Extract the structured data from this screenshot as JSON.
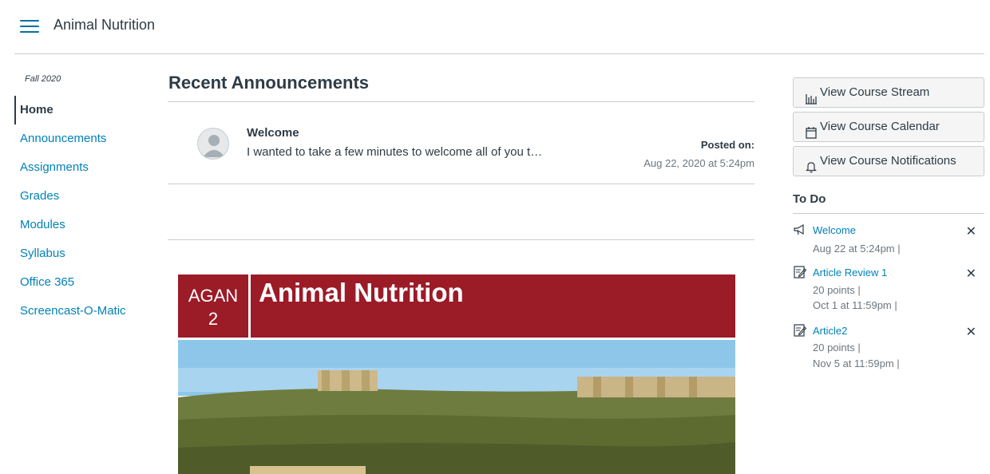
{
  "header": {
    "menu_icon": "hamburger-menu-icon",
    "course_title": "Animal Nutrition"
  },
  "sidenav": {
    "term": "Fall 2020",
    "items": [
      {
        "label": "Home",
        "active": true
      },
      {
        "label": "Announcements"
      },
      {
        "label": "Assignments"
      },
      {
        "label": "Grades"
      },
      {
        "label": "Modules"
      },
      {
        "label": "Syllabus"
      },
      {
        "label": "Office 365"
      },
      {
        "label": "Screencast-O-Matic"
      }
    ]
  },
  "announcements": {
    "heading": "Recent Announcements",
    "items": [
      {
        "title": "Welcome",
        "excerpt": "I wanted to take a few minutes to welcome all of you t…",
        "posted_label": "Posted on:",
        "posted_date": "Aug 22, 2020 at 5:24pm",
        "avatar_icon": "user-avatar-icon"
      }
    ]
  },
  "banner": {
    "code_line1": "AGAN",
    "code_line2": "2",
    "name": "Animal Nutrition",
    "color": "#9b1b27"
  },
  "sidebar": {
    "buttons": [
      {
        "label": "View Course Stream",
        "icon": "stream-chart-icon"
      },
      {
        "label": "View Course Calendar",
        "icon": "calendar-icon"
      },
      {
        "label": "View Course Notifications",
        "icon": "bell-icon"
      }
    ],
    "todo_title": "To Do",
    "todo": [
      {
        "title": "Welcome",
        "icon": "announcement-megaphone-icon",
        "meta": [
          "Aug 22 at 5:24pm  |"
        ]
      },
      {
        "title": "Article Review 1",
        "icon": "assignment-edit-icon",
        "meta": [
          "20 points  |",
          "Oct 1 at 11:59pm  |"
        ]
      },
      {
        "title": "Article2",
        "icon": "assignment-edit-icon",
        "meta": [
          "20 points  |",
          "Nov 5 at 11:59pm  |"
        ]
      }
    ],
    "close_glyph": "✕"
  },
  "colors": {
    "link": "#0081b8",
    "text": "#2d3b45",
    "muted": "#6b7780",
    "accent": "#0770a3"
  }
}
